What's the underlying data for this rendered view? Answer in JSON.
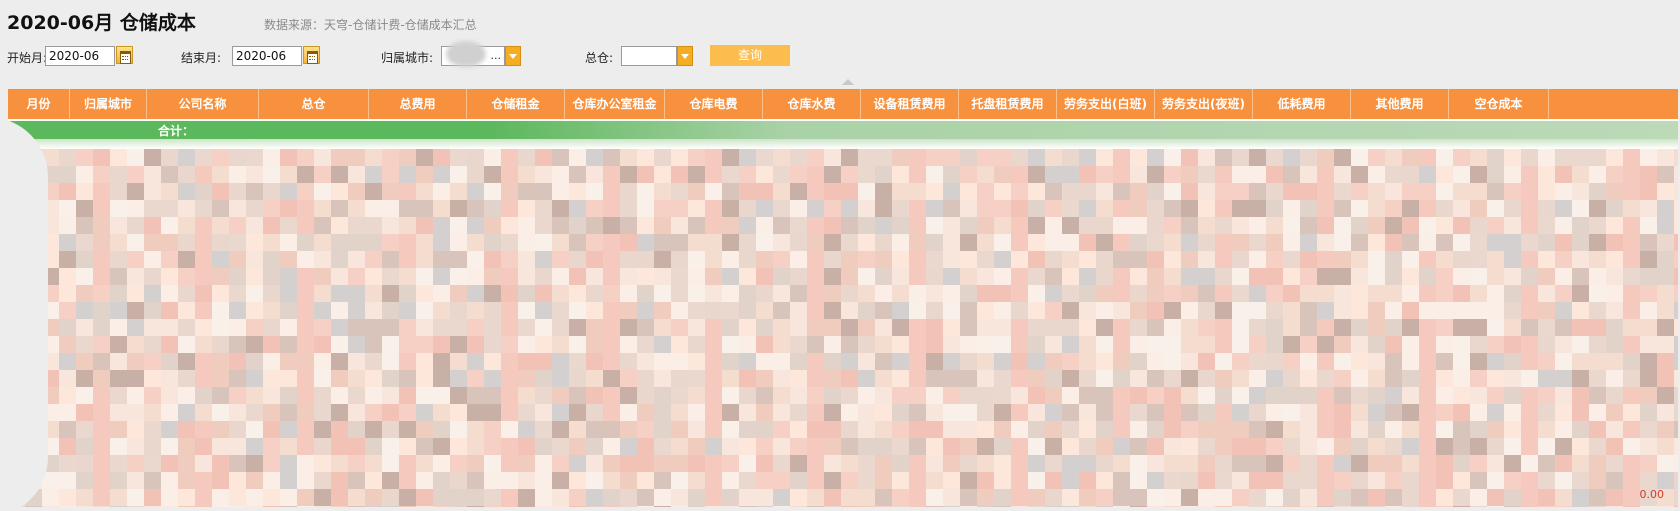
{
  "page": {
    "title": "2020-06月 仓储成本",
    "data_source": "数据来源：天穹-仓储计费-仓储成本汇总"
  },
  "filters": {
    "start_label": "开始月:",
    "start_value": "2020-06",
    "end_label": "结束月:",
    "end_value": "2020-06",
    "city_label": "归属城市:",
    "city_value": "...",
    "warehouse_label": "总仓:",
    "warehouse_value": "",
    "query_label": "查询"
  },
  "table": {
    "columns": [
      "月份",
      "归属城市",
      "公司名称",
      "总仓",
      "总费用",
      "仓储租金",
      "仓库办公室租金",
      "仓库电费",
      "仓库水费",
      "设备租赁费用",
      "托盘租赁费用",
      "劳务支出(白班)",
      "劳务支出(夜班)",
      "低耗费用",
      "其他费用",
      "空仓成本"
    ],
    "total_label": "合计：",
    "corner_value": "0.00"
  },
  "colors": {
    "header": "#f7913e",
    "total_row": "#5cb85c",
    "query_button": "#fbbd4e"
  }
}
